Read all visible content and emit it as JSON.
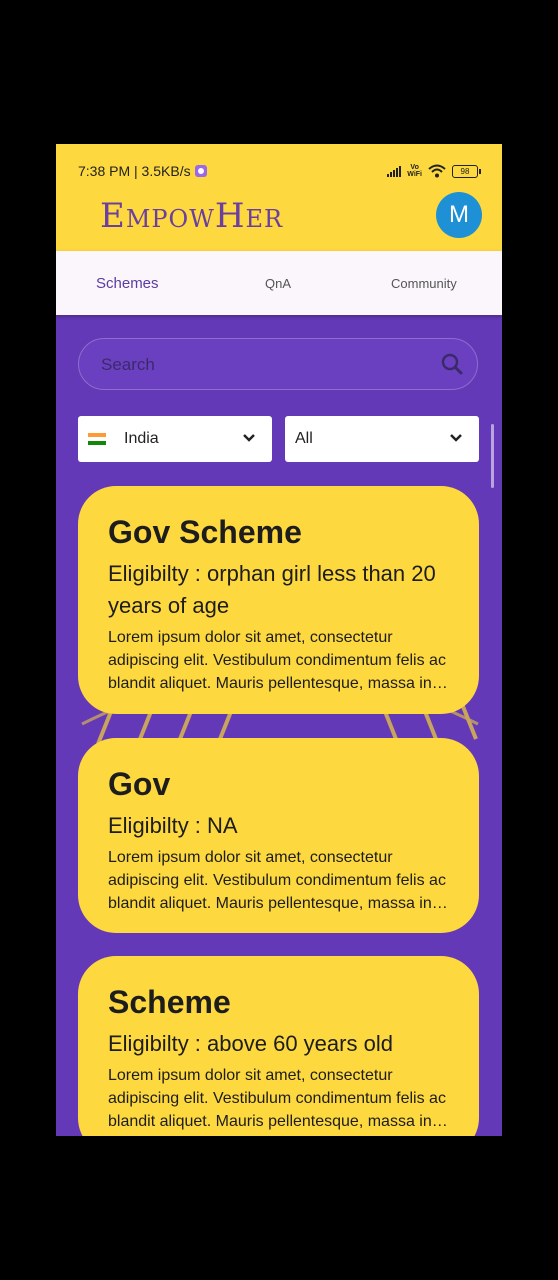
{
  "status": {
    "time_speed": "7:38 PM | 3.5KB/s",
    "vowifi": "Vo\nWiFi",
    "battery": "98"
  },
  "app": {
    "brand": "EmpowHer",
    "avatar_letter": "M"
  },
  "tabs": [
    {
      "label": "Schemes",
      "active": true
    },
    {
      "label": "QnA",
      "active": false
    },
    {
      "label": "Community",
      "active": false
    }
  ],
  "search": {
    "placeholder": "Search"
  },
  "filters": {
    "country": "India",
    "category": "All"
  },
  "schemes": [
    {
      "title": "Gov Scheme",
      "eligibility": "Eligibilty : orphan girl less than 20 years of age",
      "description": "Lorem ipsum dolor sit amet, consectetur adipiscing elit. Vestibulum condimentum felis ac blandit aliquet. Mauris pellentesque, massa in tincidunt"
    },
    {
      "title": "Gov",
      "eligibility": "Eligibilty : NA",
      "description": "Lorem ipsum dolor sit amet, consectetur adipiscing elit. Vestibulum condimentum felis ac blandit aliquet. Mauris pellentesque, massa in tincidunt"
    },
    {
      "title": "Scheme",
      "eligibility": "Eligibilty : above 60 years old",
      "description": "Lorem ipsum dolor sit amet, consectetur adipiscing elit. Vestibulum condimentum felis ac blandit aliquet. Mauris pellentesque, massa in tincidunt"
    }
  ],
  "colors": {
    "primary": "#6439B8",
    "accent": "#FDD83E",
    "avatar": "#1E90D6",
    "brand_text": "#6B3FA0"
  }
}
